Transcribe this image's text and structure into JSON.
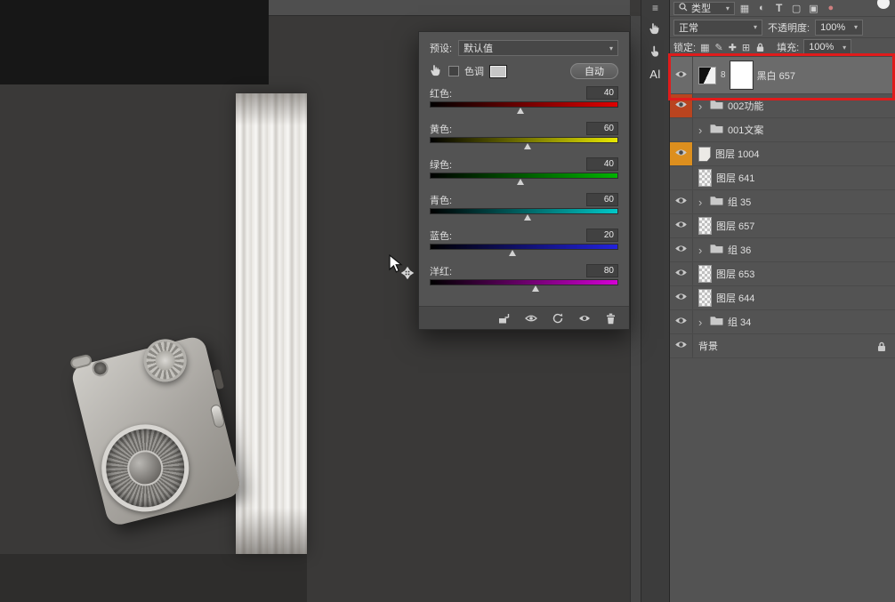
{
  "icons": {
    "dropdown_arrow": "▾",
    "chevron": "›",
    "mask_link": "8",
    "dock_collapse": "≡",
    "pixel_filter": "▦",
    "adjust_filter": "◐",
    "type_filter": "T",
    "shape_filter": "▢",
    "smart_filter": "▣",
    "filter_toggle": "●",
    "lock_transparent": "▦",
    "lock_brush": "✎",
    "lock_move": "✚",
    "lock_artboard": "⊞"
  },
  "dock": {
    "ai_label": "Al"
  },
  "bw_dialog": {
    "preset_label": "预设:",
    "preset_value": "默认值",
    "tint_label": "色调",
    "auto_button": "自动",
    "sliders": [
      {
        "label": "红色:",
        "value": 40,
        "color": "#e00000"
      },
      {
        "label": "黄色:",
        "value": 60,
        "color": "#e8e800"
      },
      {
        "label": "绿色:",
        "value": 40,
        "color": "#00b400"
      },
      {
        "label": "青色:",
        "value": 60,
        "color": "#00c8c8"
      },
      {
        "label": "蓝色:",
        "value": 20,
        "color": "#2222dd"
      },
      {
        "label": "洋红:",
        "value": 80,
        "color": "#d400d4"
      }
    ]
  },
  "layers_panel": {
    "filter_row": {
      "type_label": "类型"
    },
    "blend_row": {
      "blend_mode": "正常",
      "opacity_label": "不透明度:",
      "opacity_value": "100%"
    },
    "lock_row": {
      "lock_label": "锁定:",
      "fill_label": "填充:",
      "fill_value": "100%"
    },
    "layers": [
      {
        "name": "黑白 657",
        "kind": "adjustment",
        "visible": true,
        "selected": true
      },
      {
        "name": "002功能",
        "kind": "group",
        "visible": true,
        "label_color": "#b9441f"
      },
      {
        "name": "001文案",
        "kind": "group",
        "visible": false
      },
      {
        "name": "图层 1004",
        "kind": "smart",
        "visible": true,
        "label_color": "#dd8f1e"
      },
      {
        "name": "图层 641",
        "kind": "layer",
        "visible": false
      },
      {
        "name": "组 35",
        "kind": "group",
        "visible": true
      },
      {
        "name": "图层 657",
        "kind": "layer",
        "visible": true
      },
      {
        "name": "组 36",
        "kind": "group",
        "visible": true
      },
      {
        "name": "图层 653",
        "kind": "layer",
        "visible": true
      },
      {
        "name": "图层 644",
        "kind": "layer",
        "visible": true
      },
      {
        "name": "组 34",
        "kind": "group",
        "visible": true
      },
      {
        "name": "背景",
        "kind": "background",
        "visible": true,
        "locked": true
      }
    ]
  },
  "annotation": {
    "color": "#e01b1b"
  }
}
